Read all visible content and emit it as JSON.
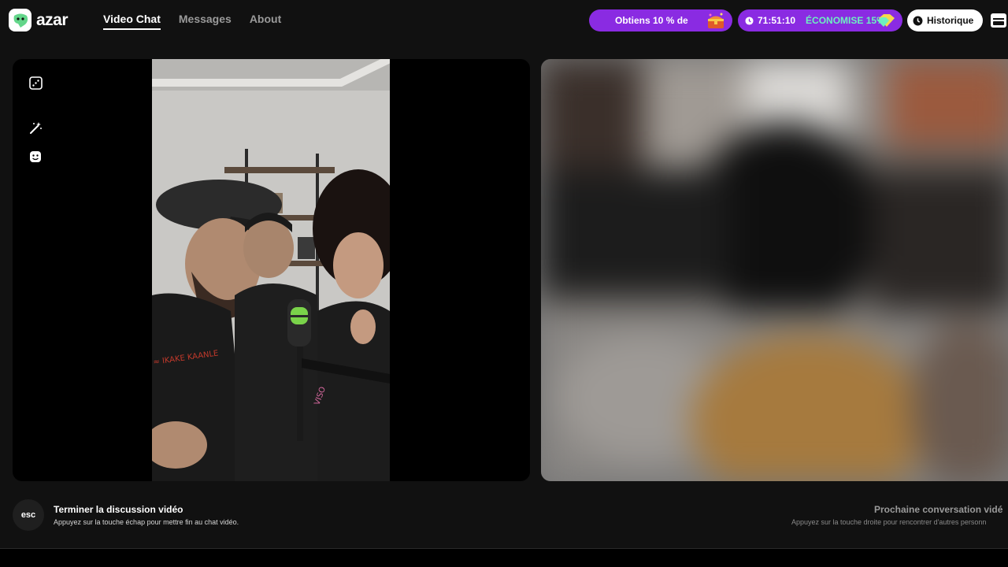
{
  "app": {
    "logo_text": "azar",
    "brand_color": "#63d68a"
  },
  "nav": {
    "items": [
      {
        "label": "Video Chat",
        "active": true
      },
      {
        "label": "Messages",
        "active": false
      },
      {
        "label": "About",
        "active": false
      }
    ]
  },
  "promo": {
    "label": "Obtiens 10 % de",
    "icon": "treasure-chest-icon",
    "color": "#8a2be2"
  },
  "timer": {
    "time": "71:51:10",
    "save_label": "ÉCONOMISE 15%",
    "icon": "clock-icon",
    "gem_icon": "gem-icon"
  },
  "history": {
    "label": "Historique",
    "icon": "clock-icon"
  },
  "store": {
    "icon": "store-icon"
  },
  "side_tools": [
    {
      "icon": "dice-icon"
    },
    {
      "icon": "magic-wand-icon"
    },
    {
      "icon": "face-icon"
    }
  ],
  "bottom": {
    "esc_key": "esc",
    "end_title": "Terminer la discussion vidéo",
    "end_subtitle": "Appuyez sur la touche échap pour mettre fin au chat vidéo.",
    "next_title": "Prochaine conversation vidé",
    "next_subtitle": "Appuyez sur la touche droite pour rencontrer d'autres personn"
  }
}
